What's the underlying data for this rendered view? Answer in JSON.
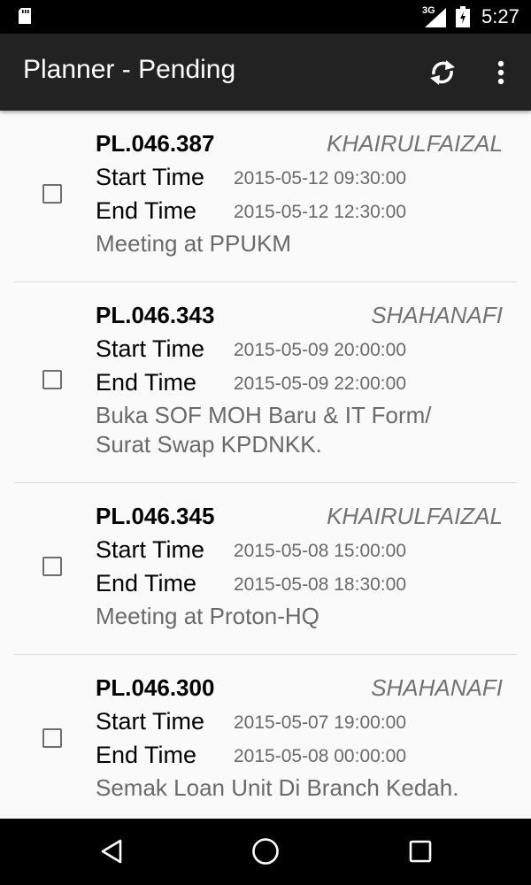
{
  "status_bar": {
    "network": "3G",
    "time": "5:27",
    "icons": [
      "sd-card-icon",
      "signal-icon",
      "battery-icon"
    ]
  },
  "app_bar": {
    "title": "Planner - Pending",
    "actions": [
      "refresh-icon",
      "overflow-menu-icon"
    ]
  },
  "labels": {
    "start": "Start Time",
    "end": "End Time"
  },
  "items": [
    {
      "code": "PL.046.387",
      "user": "KHAIRULFAIZAL",
      "start": "2015-05-12 09:30:00",
      "end": "2015-05-12 12:30:00",
      "description": "Meeting at PPUKM",
      "checked": false
    },
    {
      "code": "PL.046.343",
      "user": "SHAHANAFI",
      "start": "2015-05-09 20:00:00",
      "end": "2015-05-09 22:00:00",
      "description": "Buka SOF MOH Baru & IT Form/ Surat Swap KPDNKK.",
      "checked": false
    },
    {
      "code": "PL.046.345",
      "user": "KHAIRULFAIZAL",
      "start": "2015-05-08 15:00:00",
      "end": "2015-05-08 18:30:00",
      "description": "Meeting at Proton-HQ",
      "checked": false
    },
    {
      "code": "PL.046.300",
      "user": "SHAHANAFI",
      "start": "2015-05-07 19:00:00",
      "end": "2015-05-08 00:00:00",
      "description": "Semak Loan Unit Di Branch Kedah.",
      "checked": false
    }
  ],
  "nav_bar": {
    "buttons": [
      "back-icon",
      "home-icon",
      "recents-icon"
    ]
  },
  "colors": {
    "app_bar": "#222222",
    "background": "#fafafa",
    "secondary_text": "#6a6a6a",
    "divider": "#dcdcdc"
  }
}
